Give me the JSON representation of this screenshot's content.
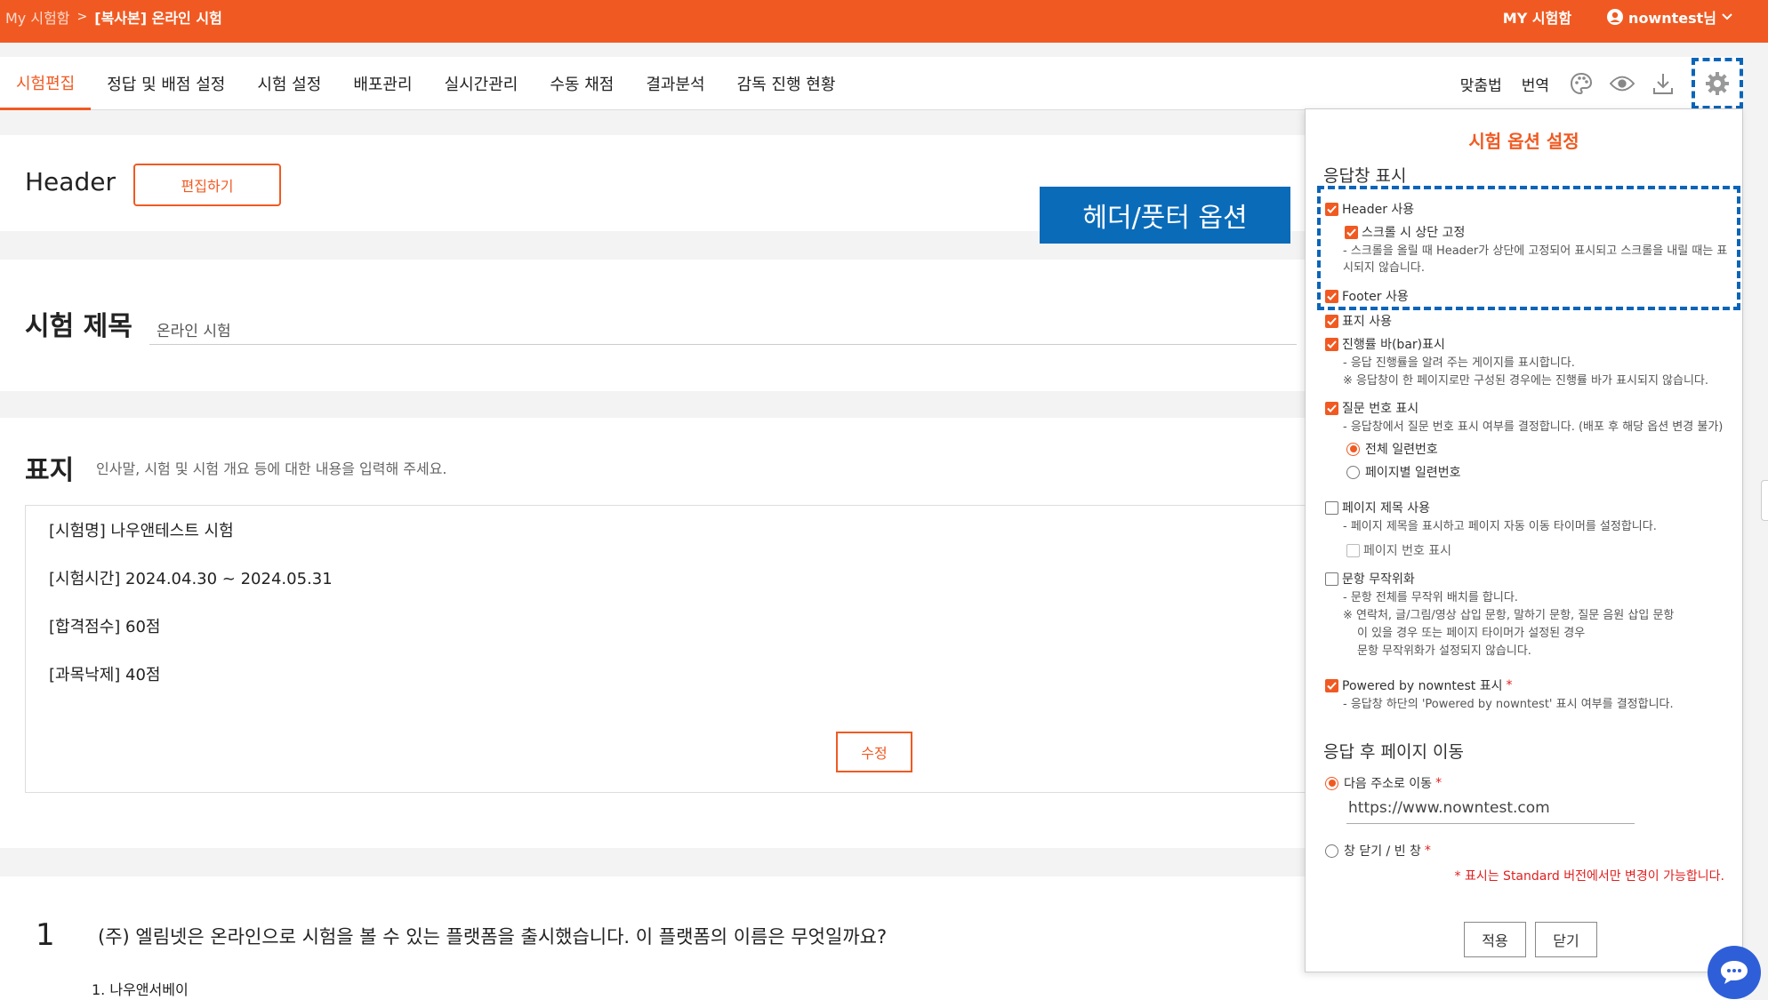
{
  "topbar": {
    "breadcrumb_root": "My 시험함",
    "breadcrumb_current": "[복사본] 온라인 시험",
    "my_box": "MY 시험함",
    "user": "nowntest님"
  },
  "tabs": [
    "시험편집",
    "정답 및 배점 설정",
    "시험 설정",
    "배포관리",
    "실시간관리",
    "수동 채점",
    "결과분석",
    "감독 진행 현황"
  ],
  "tools": {
    "spellcheck": "맞춤법",
    "translate": "번역"
  },
  "header_section": {
    "label": "Header",
    "edit_button": "편집하기",
    "callout": "헤더/풋터 옵션"
  },
  "title_section": {
    "label": "시험 제목",
    "value": "온라인 시험"
  },
  "cover_section": {
    "label": "표지",
    "help": "인사말, 시험 및 시험 개요 등에 대한 내용을 입력해 주세요.",
    "lines": [
      "[시험명] 나우앤테스트 시험",
      "[시험시간] 2024.04.30 ~ 2024.05.31",
      "[합격점수] 60점",
      "[과목낙제] 40점"
    ],
    "modify_button": "수정"
  },
  "question": {
    "number": "1",
    "text": "(주) 엘림넷은 온라인으로 시험을 볼 수 있는 플랫폼을 출시했습니다. 이 플랫폼의 이름은 무엇일까요?",
    "first_option": "1.  나우앤서베이"
  },
  "panel": {
    "title": "시험 옵션 설정",
    "display_section": "응답창 표시",
    "header_use": "Header 사용",
    "scroll_fix": "스크롤 시 상단 고정",
    "scroll_fix_desc": "- 스크롤을 올릴 때 Header가 상단에 고정되어 표시되고 스크롤을 내릴 때는 표시되지 않습니다.",
    "footer_use": "Footer 사용",
    "cover_use": "표지 사용",
    "progress_bar": "진행률 바(bar)표시",
    "progress_desc1": "- 응답 진행률을 알려 주는 게이지를 표시합니다.",
    "progress_desc2": "※ 응답창이 한 페이지로만 구성된 경우에는 진행률 바가 표시되지 않습니다.",
    "qnum": "질문 번호 표시",
    "qnum_desc": "- 응답창에서 질문 번호 표시 여부를 결정합니다. (배포 후 해당 옵션 변경 불가)",
    "qnum_all": "전체 일련번호",
    "qnum_page": "페이지별 일련번호",
    "page_title": "페이지 제목 사용",
    "page_title_desc": "- 페이지 제목을 표시하고 페이지 자동 이동 타이머를 설정합니다.",
    "page_number": "페이지 번호 표시",
    "randomize": "문항 무작위화",
    "randomize_desc1": "- 문항 전체를 무작위 배치를 합니다.",
    "randomize_desc2": "※ 연락처, 글/그림/영상 삽입 문항, 말하기 문항, 질문 음원 삽입 문항",
    "randomize_desc3": "이 있을 경우 또는 페이지 타이머가 설정된 경우",
    "randomize_desc4": "문항 무작위화가 설정되지 않습니다.",
    "powered": "Powered by nowntest 표시",
    "powered_desc": "- 응답창 하단의 'Powered by nowntest' 표시 여부를 결정합니다.",
    "after_section": "응답 후 페이지 이동",
    "goto_url": "다음 주소로 이동",
    "url_value": "https://www.nowntest.com",
    "close_window": "창 닫기 / 빈 창",
    "required_mark": "*",
    "notice": "* 표시는 Standard 버전에서만 변경이 가능합니다.",
    "apply": "적용",
    "close": "닫기"
  },
  "colors": {
    "brand": "#f05a22",
    "callout": "#0a6bb9",
    "chat": "#2f5fd8"
  }
}
